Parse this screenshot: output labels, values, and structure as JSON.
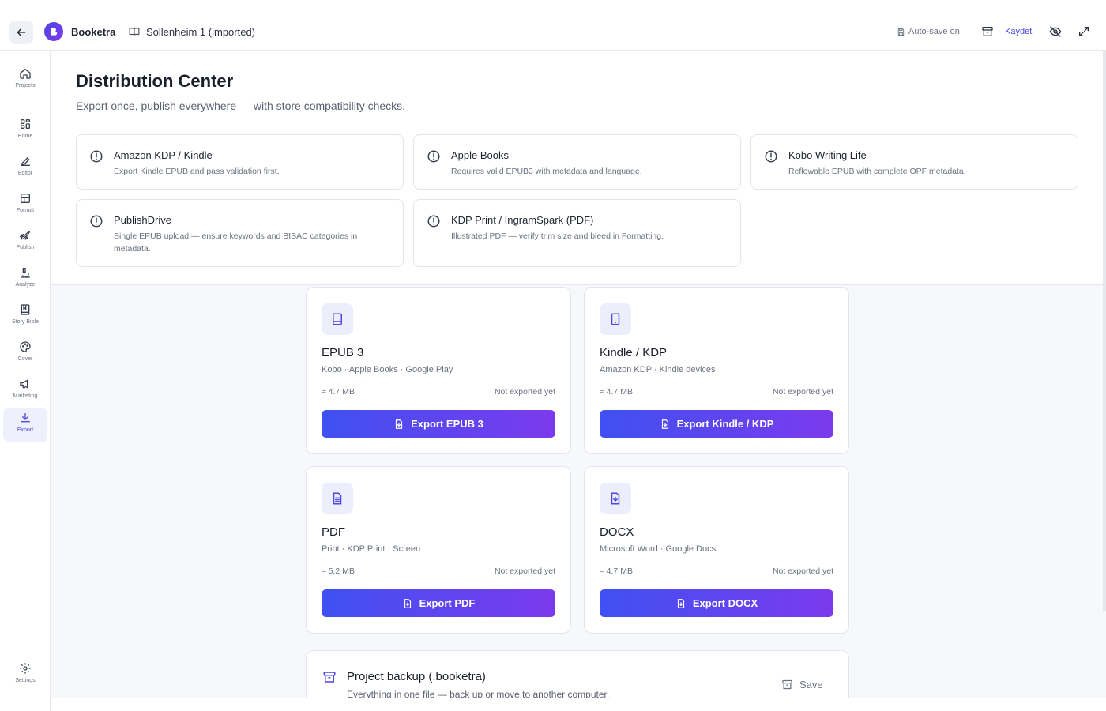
{
  "topbar": {
    "app_name": "Booketra",
    "project_name": "Sollenheim 1 (imported)",
    "autosave_label": "Auto-save on",
    "save_label": "Kaydet"
  },
  "sidebar": {
    "items": [
      {
        "label": "Projects",
        "icon": "home-icon"
      },
      {
        "label": "Home",
        "icon": "grid-icon"
      },
      {
        "label": "Editor",
        "icon": "pen-icon"
      },
      {
        "label": "Format",
        "icon": "layout-icon"
      },
      {
        "label": "Publish",
        "icon": "rocket-icon"
      },
      {
        "label": "Analyze",
        "icon": "microscope-icon"
      },
      {
        "label": "Story Bible",
        "icon": "book-icon"
      },
      {
        "label": "Cover",
        "icon": "palette-icon"
      },
      {
        "label": "Marketing",
        "icon": "megaphone-icon"
      },
      {
        "label": "Export",
        "icon": "download-icon"
      }
    ],
    "settings_label": "Settings"
  },
  "page": {
    "title": "Distribution Center",
    "subtitle": "Export once, publish everywhere — with store compatibility checks."
  },
  "stores": [
    {
      "name": "Amazon KDP / Kindle",
      "desc": "Export Kindle EPUB and pass validation first."
    },
    {
      "name": "Apple Books",
      "desc": "Requires valid EPUB3 with metadata and language."
    },
    {
      "name": "Kobo Writing Life",
      "desc": "Reflowable EPUB with complete OPF metadata."
    },
    {
      "name": "PublishDrive",
      "desc": "Single EPUB upload — ensure keywords and BISAC categories in metadata."
    },
    {
      "name": "KDP Print / IngramSpark (PDF)",
      "desc": "Illustrated PDF — verify trim size and bleed in Formatting."
    }
  ],
  "formats": [
    {
      "title": "EPUB 3",
      "subtitle": "Kobo · Apple Books · Google Play",
      "size": "≈ 4.7 MB",
      "status": "Not exported yet",
      "button": "Export EPUB 3"
    },
    {
      "title": "Kindle / KDP",
      "subtitle": "Amazon KDP · Kindle devices",
      "size": "≈ 4.7 MB",
      "status": "Not exported yet",
      "button": "Export Kindle / KDP"
    },
    {
      "title": "PDF",
      "subtitle": "Print · KDP Print · Screen",
      "size": "≈ 5.2 MB",
      "status": "Not exported yet",
      "button": "Export PDF"
    },
    {
      "title": "DOCX",
      "subtitle": "Microsoft Word · Google Docs",
      "size": "≈ 4.7 MB",
      "status": "Not exported yet",
      "button": "Export DOCX"
    }
  ],
  "backup": {
    "title": "Project backup (.booketra)",
    "subtitle": "Everything in one file — back up or move to another computer.",
    "save_label": "Save"
  },
  "colors": {
    "accent": "#4f46e5",
    "button_gradient_start": "#3f51f2",
    "button_gradient_end": "#7c3aed"
  }
}
